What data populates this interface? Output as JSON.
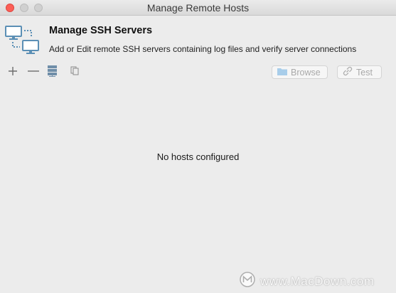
{
  "window": {
    "title": "Manage Remote Hosts"
  },
  "header": {
    "title": "Manage SSH Servers",
    "subtitle": "Add or Edit remote SSH servers containing log files and verify server connections",
    "icon": "network-computers-icon"
  },
  "toolbar": {
    "add_icon": "plus-icon",
    "remove_icon": "minus-icon",
    "server_icon": "server-stack-icon",
    "duplicate_icon": "copy-icon",
    "browse_label": "Browse",
    "browse_icon": "folder-icon",
    "test_label": "Test",
    "test_icon": "link-icon"
  },
  "hosts": {
    "empty_message": "No hosts configured"
  },
  "watermark": {
    "text": "www.MacDown.com"
  },
  "colors": {
    "close": "#fc5f57",
    "inactive_control": "#d0d0d0",
    "window_bg": "#ececec",
    "icon_blue": "#5b8fb5"
  }
}
